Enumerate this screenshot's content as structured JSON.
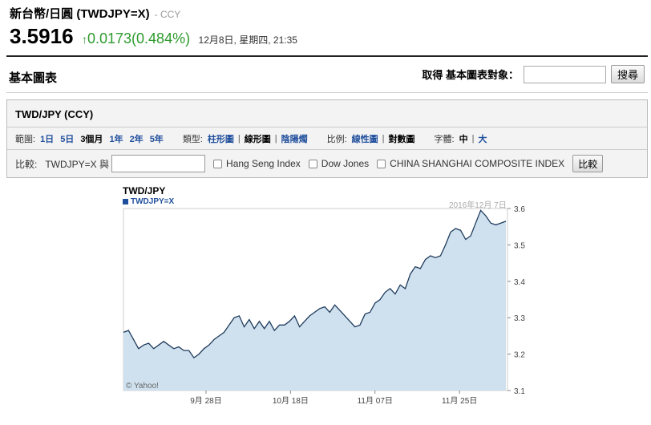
{
  "quote": {
    "name": "新台幣/日圓 (TWDJPY=X)",
    "exchange": "- CCY",
    "price": "3.5916",
    "change_arrow": "↑",
    "change": "0.0173(0.484%)",
    "time": "12月8日, 星期四, 21:35"
  },
  "section": {
    "title": "基本圖表",
    "search_label": "取得 基本圖表對象：",
    "search_placeholder": "",
    "search_button": "搜尋"
  },
  "panel": {
    "title": "TWD/JPY (CCY)",
    "range_label": "範圍:",
    "ranges": [
      "1日",
      "5日",
      "3個月",
      "1年",
      "2年",
      "5年"
    ],
    "type_label": "類型:",
    "types": [
      "柱形圖",
      "線形圖",
      "陰陽燭"
    ],
    "scale_label": "比例:",
    "scales": [
      "線性圖",
      "對數圖"
    ],
    "font_label": "字體:",
    "fonts": [
      "中",
      "大"
    ],
    "compare_label": "比較:",
    "compare_symbol": "TWDJPY=X 與",
    "compare_items": [
      "Hang Seng Index",
      "Dow Jones",
      "CHINA SHANGHAI COMPOSITE INDEX"
    ],
    "compare_button": "比較"
  },
  "colors": {
    "up": "#2d9a2d",
    "link": "#1f4e9c",
    "line": "#1f3b5c",
    "fill": "#cfe1ee"
  },
  "chart_data": {
    "type": "area",
    "title": "TWD/JPY",
    "legend": [
      "TWDJPY=X"
    ],
    "date_label": "2016年12月 7日",
    "credit": "© Yahoo!",
    "ylim": [
      3.1,
      3.6
    ],
    "yticks": [
      "3.6",
      "3.5",
      "3.4",
      "3.3",
      "3.2",
      "3.1"
    ],
    "xticks": [
      "9月 28日",
      "10月 18日",
      "11月 07日",
      "11月 25日"
    ],
    "series": [
      {
        "values": [
          3.26,
          3.265,
          3.24,
          3.215,
          3.225,
          3.23,
          3.215,
          3.225,
          3.235,
          3.225,
          3.215,
          3.22,
          3.21,
          3.21,
          3.19,
          3.2,
          3.215,
          3.225,
          3.24,
          3.25,
          3.26,
          3.28,
          3.3,
          3.305,
          3.275,
          3.295,
          3.27,
          3.29,
          3.27,
          3.29,
          3.265,
          3.28,
          3.28,
          3.29,
          3.305,
          3.275,
          3.29,
          3.305,
          3.315,
          3.325,
          3.33,
          3.315,
          3.335,
          3.32,
          3.305,
          3.29,
          3.275,
          3.28,
          3.31,
          3.315,
          3.34,
          3.35,
          3.37,
          3.38,
          3.365,
          3.39,
          3.38,
          3.42,
          3.44,
          3.435,
          3.46,
          3.47,
          3.465,
          3.47,
          3.5,
          3.535,
          3.545,
          3.54,
          3.515,
          3.525,
          3.56,
          3.595,
          3.58,
          3.56,
          3.555,
          3.56,
          3.565
        ]
      }
    ]
  }
}
